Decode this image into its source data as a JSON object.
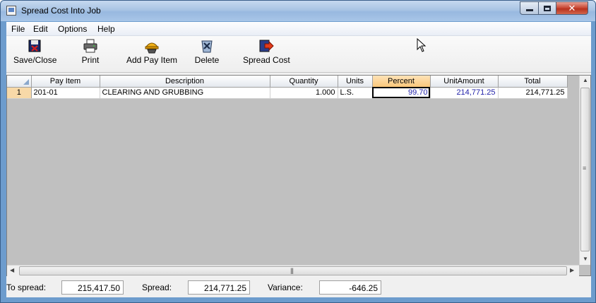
{
  "window": {
    "title": "Spread Cost Into Job"
  },
  "menu": [
    {
      "label": "File"
    },
    {
      "label": "Edit"
    },
    {
      "label": "Options"
    },
    {
      "label": "Help"
    }
  ],
  "toolbar": {
    "save_close": "Save/Close",
    "print": "Print",
    "add_pay_item": "Add Pay Item",
    "delete": "Delete",
    "spread_cost": "Spread Cost"
  },
  "grid": {
    "columns": [
      "",
      "Pay Item",
      "Description",
      "Quantity",
      "Units",
      "Percent",
      "UnitAmount",
      "Total"
    ],
    "active_column": "Percent",
    "rows": [
      {
        "row": "1",
        "pay_item": "201-01",
        "description": "CLEARING AND GRUBBING",
        "quantity": "1.000",
        "units": "L.S.",
        "percent": "99.70",
        "unit_amount": "214,771.25",
        "total": "214,771.25"
      }
    ]
  },
  "footer": {
    "to_spread_label": "To spread:",
    "to_spread_value": "215,417.50",
    "spread_label": "Spread:",
    "spread_value": "214,771.25",
    "variance_label": "Variance:",
    "variance_value": "-646.25"
  },
  "colors": {
    "title_bar": "#a9c4e4",
    "active_header": "#f9c77a",
    "unit_amount_text": "#1f1fa8",
    "close_button": "#c7432f"
  }
}
